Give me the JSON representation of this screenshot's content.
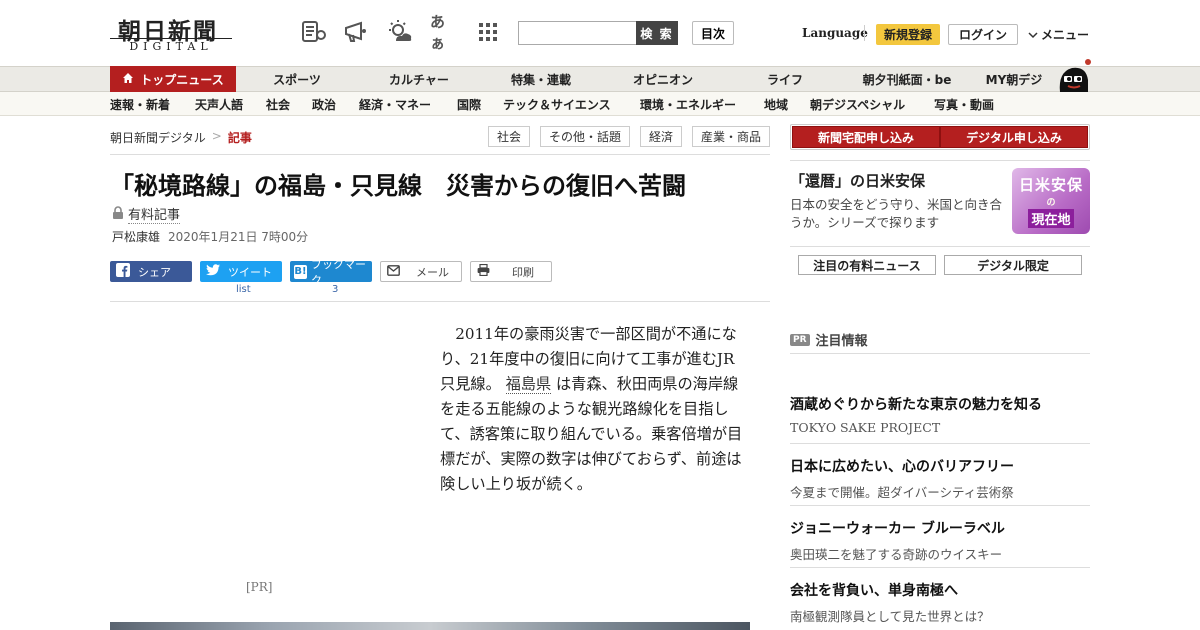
{
  "header": {
    "logo_main": "朝日新聞",
    "logo_sub": "DIGITAL",
    "search_button": "検 索",
    "search_placeholder": "",
    "toc_button": "目次",
    "language": "Language",
    "register": "新規登録",
    "login": "ログイン",
    "menu": "メニュー",
    "font_size_icon_text": "あぁ"
  },
  "nav_main": [
    {
      "label": "トップニュース"
    },
    {
      "label": "スポーツ"
    },
    {
      "label": "カルチャー"
    },
    {
      "label": "特集・連載"
    },
    {
      "label": "オピニオン"
    },
    {
      "label": "ライフ"
    },
    {
      "label": "朝夕刊紙面・be"
    },
    {
      "label": "MY朝デジ"
    }
  ],
  "nav_sub": [
    {
      "label": "速報・新着"
    },
    {
      "label": "天声人語"
    },
    {
      "label": "社会"
    },
    {
      "label": "政治"
    },
    {
      "label": "経済・マネー"
    },
    {
      "label": "国際"
    },
    {
      "label": "テック＆サイエンス"
    },
    {
      "label": "環境・エネルギー"
    },
    {
      "label": "地域"
    },
    {
      "label": "朝デジスペシャル"
    },
    {
      "label": "写真・動画"
    }
  ],
  "breadcrumb": {
    "home": "朝日新聞デジタル",
    "separator": ">",
    "current": "記事"
  },
  "tags": [
    {
      "label": "社会"
    },
    {
      "label": "その他・話題"
    },
    {
      "label": "経済"
    },
    {
      "label": "産業・商品"
    }
  ],
  "article": {
    "title": "「秘境路線」の福島・只見線　災害からの復旧へ苦闘",
    "paid_label": "有料記事",
    "author": "戸松康雄",
    "date": "2020年1月21日 7時00分",
    "lead_before": "2011年の豪雨災害で一部区間が不通になり、21年度中の復旧に向けて工事が進むJR只見線。",
    "lead_link": "福島県",
    "lead_after": "は青森、秋田両県の海岸線を走る五能線のような観光路線化を目指して、誘客策に取り組んでいる。乗客倍増が目標だが、実際の数字は伸びておらず、前途は険しい上り坂が続く。",
    "pr_label": "[PR]"
  },
  "share": {
    "facebook": "シェア",
    "twitter": "ツイート",
    "twitter_count": "list",
    "hatena": "ブックマーク",
    "hatena_count": "3",
    "mail": "メール",
    "print": "印刷"
  },
  "sidebar": {
    "sub_home": "新聞宅配申し込み",
    "sub_digital": "デジタル申し込み",
    "feature_title": "「還暦」の日米安保",
    "feature_desc": "日本の安全をどう守り、米国と向き合うか。シリーズで探ります",
    "badge_line1": "日米安保",
    "badge_line2": "の",
    "badge_line3": "現在地",
    "btn_paid_news": "注目の有料ニュース",
    "btn_digital_only": "デジタル限定",
    "pr_badge": "PR",
    "pr_heading": "注目情報",
    "pr_items": [
      {
        "title": "酒蔵めぐりから新たな東京の魅力を知る",
        "sub": "TOKYO SAKE PROJECT"
      },
      {
        "title": "日本に広めたい、心のバリアフリー",
        "sub": "今夏まで開催。超ダイバーシティ芸術祭"
      },
      {
        "title": "ジョニーウォーカー ブルーラベル",
        "sub": "奥田瑛二を魅了する奇跡のウイスキー"
      },
      {
        "title": "会社を背負い、単身南極へ",
        "sub": "南極観測隊員として見た世界とは？"
      }
    ]
  },
  "colors": {
    "brand_red": "#b41f1f",
    "register_yellow": "#f3c73e",
    "facebook": "#3b5998",
    "twitter": "#1da1f2",
    "hatena": "#1e88d0"
  }
}
